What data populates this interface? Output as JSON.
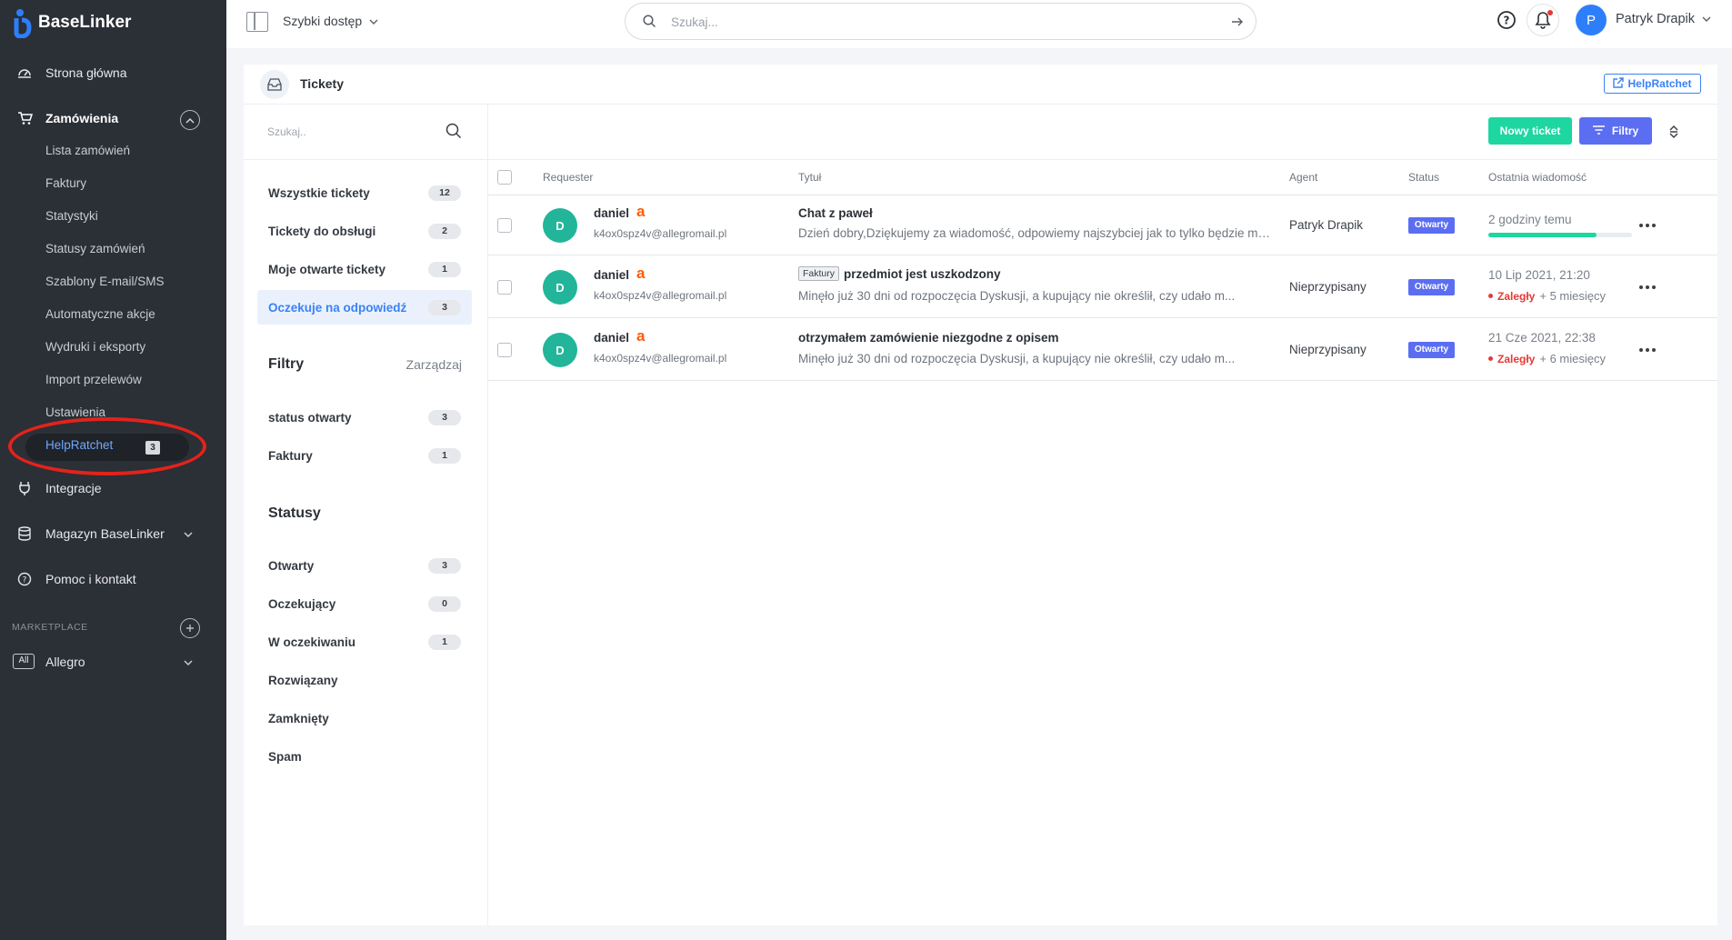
{
  "app": {
    "logo_text": "BaseLinker"
  },
  "sidebar": {
    "home": "Strona główna",
    "orders": "Zamówienia",
    "order_items": [
      "Lista zamówień",
      "Faktury",
      "Statystyki",
      "Statusy zamówień",
      "Szablony E-mail/SMS",
      "Automatyczne akcje",
      "Wydruki i eksporty",
      "Import przelewów",
      "Ustawienia"
    ],
    "helpratchet": {
      "label": "HelpRatchet",
      "badge": "3"
    },
    "integrations": "Integracje",
    "warehouse": "Magazyn BaseLinker",
    "help": "Pomoc i kontakt",
    "marketplace_label": "MARKETPLACE",
    "allegro": {
      "box": "All",
      "label": "Allegro"
    }
  },
  "topbar": {
    "quick_access": "Szybki dostęp",
    "search_placeholder": "Szukaj...",
    "avatar_letter": "P",
    "user_name": "Patryk Drapik"
  },
  "panel": {
    "title": "Tickety",
    "helpratchet_link": "HelpRatchet",
    "left_search_placeholder": "Szukaj..",
    "views": [
      {
        "label": "Wszystkie tickety",
        "count": "12"
      },
      {
        "label": "Tickety do obsługi",
        "count": "2"
      },
      {
        "label": "Moje otwarte tickety",
        "count": "1"
      },
      {
        "label": "Oczekuje na odpowiedź",
        "count": "3"
      }
    ],
    "filters_heading": "Filtry",
    "manage": "Zarządzaj",
    "filters": [
      {
        "label": "status otwarty",
        "count": "3"
      },
      {
        "label": "Faktury",
        "count": "1"
      }
    ],
    "statuses_heading": "Statusy",
    "statuses": [
      {
        "label": "Otwarty",
        "count": "3"
      },
      {
        "label": "Oczekujący",
        "count": "0"
      },
      {
        "label": "W oczekiwaniu",
        "count": "1"
      },
      {
        "label": "Rozwiązany",
        "count": ""
      },
      {
        "label": "Zamknięty",
        "count": ""
      },
      {
        "label": "Spam",
        "count": ""
      }
    ]
  },
  "toolbar": {
    "new_ticket": "Nowy ticket",
    "filters": "Filtry"
  },
  "table": {
    "columns": [
      "Requester",
      "Tytuł",
      "Agent",
      "Status",
      "Ostatnia wiadomość"
    ],
    "rows": [
      {
        "avatar": "D",
        "name": "daniel",
        "marketplace_mark": "a",
        "email": "k4ox0spz4v@allegromail.pl",
        "tag": "",
        "title": "Chat z paweł",
        "snippet": "Dzień dobry,Dziękujemy za wiadomość, odpowiemy najszybciej jak to tylko będzie możliwe.",
        "agent": "Patryk Drapik",
        "status": "Otwarty",
        "last_message": "2 godziny temu",
        "progress": 0.75,
        "overdue": "",
        "overdue_more": ""
      },
      {
        "avatar": "D",
        "name": "daniel",
        "marketplace_mark": "a",
        "email": "k4ox0spz4v@allegromail.pl",
        "tag": "Faktury",
        "title": "przedmiot jest uszkodzony",
        "snippet": "Minęło już 30 dni od rozpoczęcia Dyskusji, a kupujący nie określił, czy udało m...",
        "agent": "Nieprzypisany",
        "status": "Otwarty",
        "last_message": "10 Lip 2021, 21:20",
        "progress": null,
        "overdue": "Zaległy",
        "overdue_more": "+ 5 miesięcy"
      },
      {
        "avatar": "D",
        "name": "daniel",
        "marketplace_mark": "a",
        "email": "k4ox0spz4v@allegromail.pl",
        "tag": "",
        "title": "otrzymałem zamówienie niezgodne z opisem",
        "snippet": "Minęło już 30 dni od rozpoczęcia Dyskusji, a kupujący nie określił, czy udało m...",
        "agent": "Nieprzypisany",
        "status": "Otwarty",
        "last_message": "21 Cze 2021, 22:38",
        "progress": null,
        "overdue": "Zaległy",
        "overdue_more": "+ 6 miesięcy"
      }
    ]
  },
  "colors": {
    "sidebar_bg": "#2b2f36",
    "accent_blue": "#3b82f6",
    "new_ticket_green": "#1ed6a0",
    "status_badge": "#5b6ef2",
    "avatar_teal": "#22b59a",
    "overdue_red": "#e53935",
    "allegro_orange": "#ff5a00",
    "highlight_ellipse": "#e2231a"
  }
}
